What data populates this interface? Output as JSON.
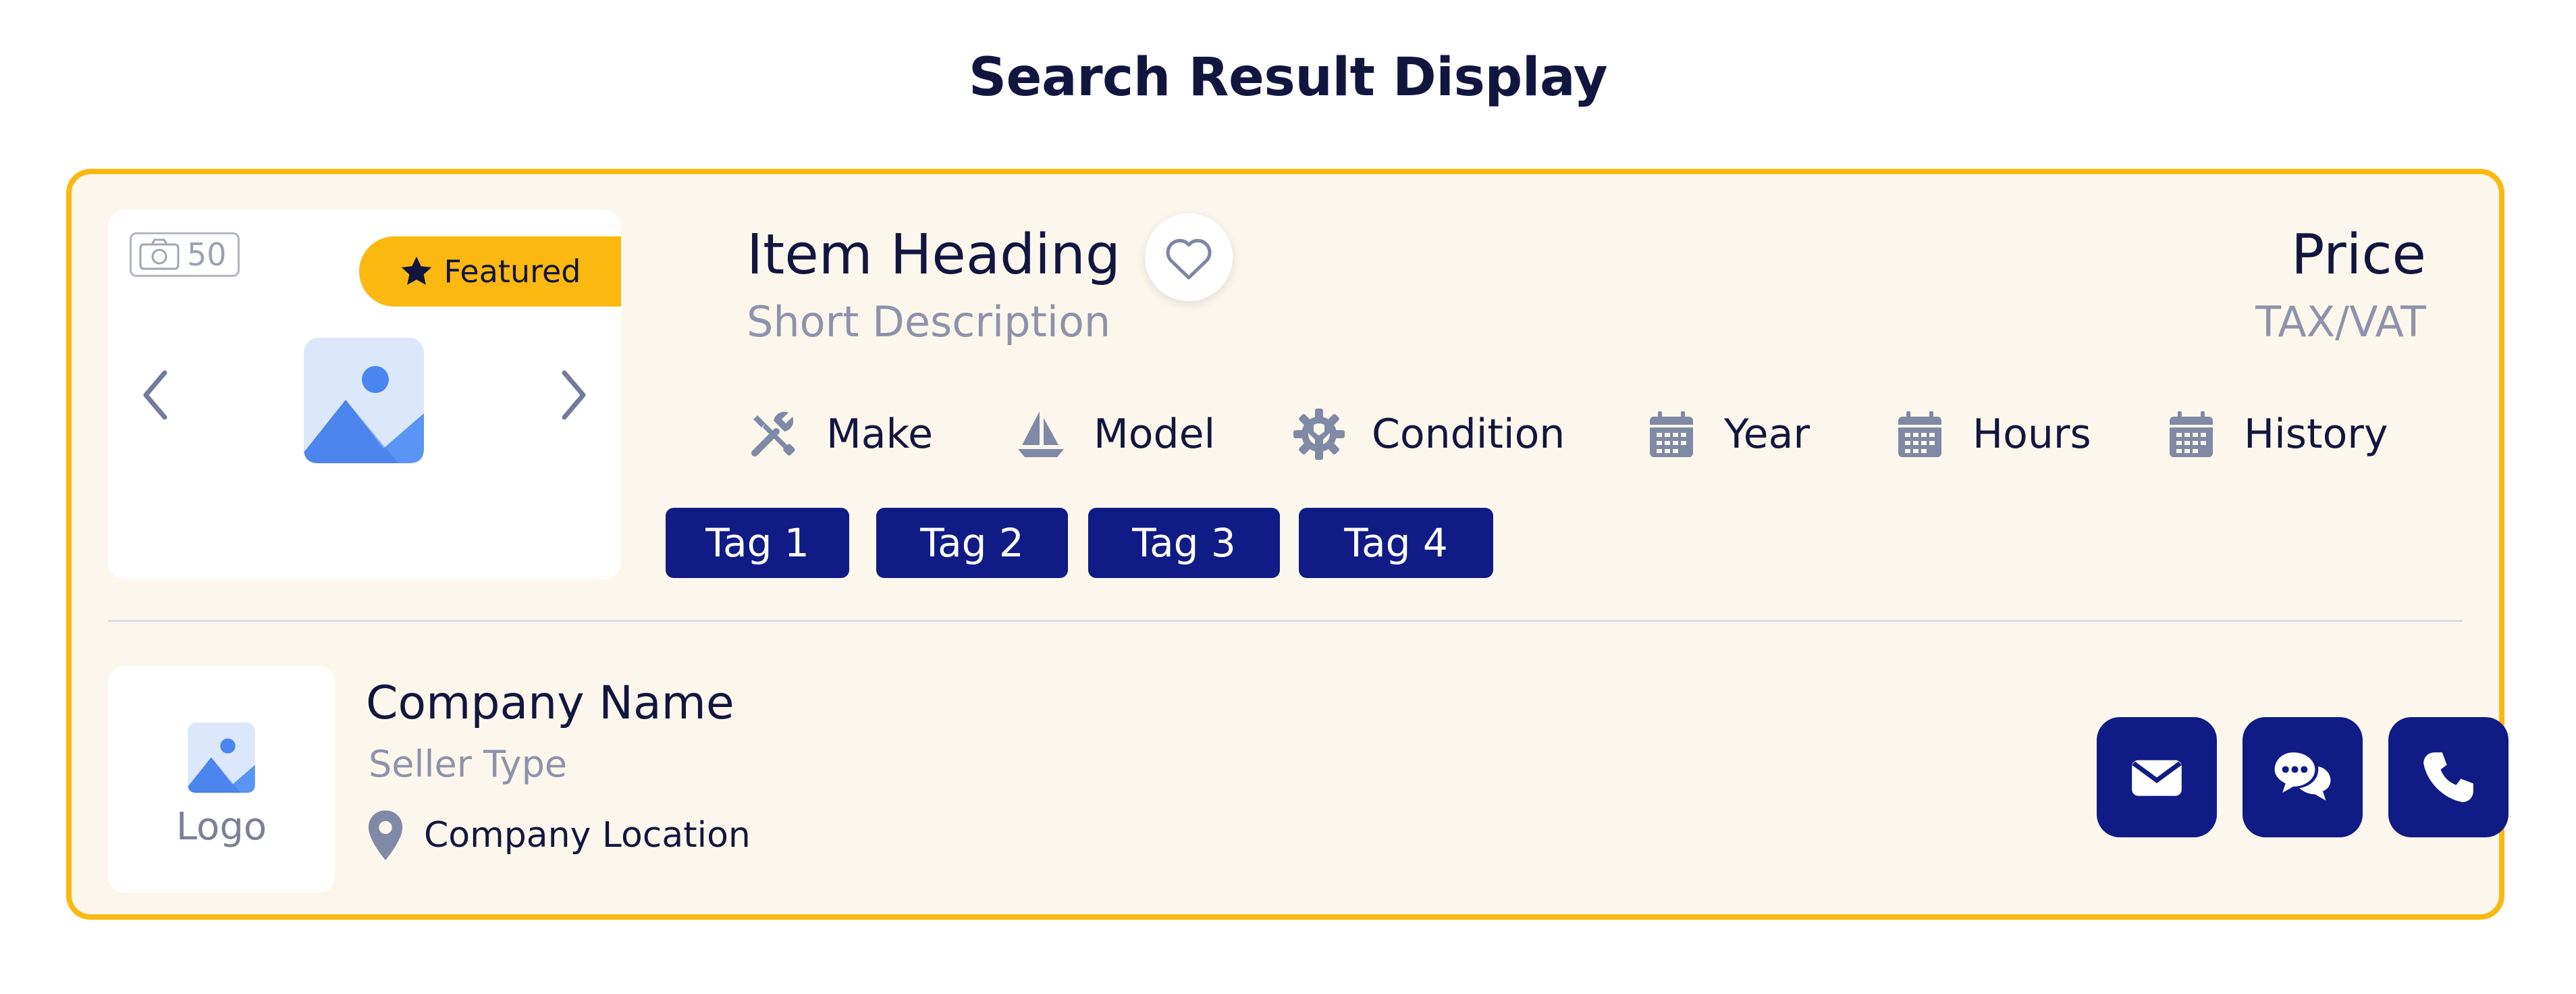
{
  "page": {
    "title": "Search Result Display"
  },
  "colors": {
    "accent": "#fbb811",
    "primary": "#101b86",
    "card_bg": "#fcf7ec",
    "muted": "#8e93ab"
  },
  "listing": {
    "gallery": {
      "photo_count": "50",
      "badge": "Featured",
      "image_icon": "image-placeholder-icon"
    },
    "heading": "Item Heading",
    "short_description": "Short Description",
    "price": "Price",
    "tax_label": "TAX/VAT",
    "favorite_icon": "heart-icon",
    "specs": [
      {
        "label": "Make",
        "icon": "tools-icon"
      },
      {
        "label": "Model",
        "icon": "sailboat-icon"
      },
      {
        "label": "Condition",
        "icon": "gear-wrench-icon"
      },
      {
        "label": "Year",
        "icon": "calendar-icon"
      },
      {
        "label": "Hours",
        "icon": "calendar-icon"
      },
      {
        "label": "History",
        "icon": "calendar-icon"
      }
    ],
    "tags": [
      "Tag 1",
      "Tag 2",
      "Tag 3",
      "Tag 4"
    ]
  },
  "seller": {
    "logo_label": "Logo",
    "company_name": "Company Name",
    "seller_type": "Seller Type",
    "location": "Company Location",
    "actions": [
      {
        "icon": "mail-icon"
      },
      {
        "icon": "chat-icon"
      },
      {
        "icon": "phone-icon"
      }
    ]
  }
}
